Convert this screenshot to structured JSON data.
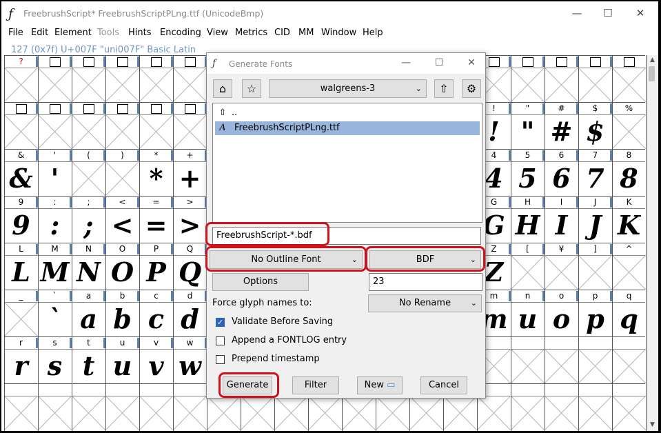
{
  "window": {
    "title": "FreebrushScript*  FreebrushScriptPLng.ttf (UnicodeBmp)",
    "app_icon": "fontforge-icon",
    "controls": {
      "minimize": "—",
      "maximize": "☐",
      "close": "✕"
    }
  },
  "menu": [
    "File",
    "Edit",
    "Element",
    "Tools",
    "Hints",
    "Encoding",
    "View",
    "Metrics",
    "CID",
    "MM",
    "Window",
    "Help"
  ],
  "menu_disabled": [
    "Tools"
  ],
  "info_line": "127 (0x7f) U+007F \"uni007F\" Basic Latin",
  "grid": {
    "rows": [
      {
        "labels": [
          "?",
          "▯",
          "▯",
          "▯",
          "▯",
          "▯",
          "",
          "",
          "",
          "",
          "",
          "",
          "",
          "",
          "▯",
          "▯",
          "▯",
          "▯",
          "▯"
        ],
        "glyphs": [
          "",
          "",
          "",
          "",
          "",
          "",
          "",
          "",
          "",
          "",
          "",
          "",
          "",
          "",
          "",
          "",
          "",
          "",
          ""
        ]
      },
      {
        "labels": [
          "▯",
          "▯",
          "▯",
          "▯",
          "▯",
          "▯",
          "",
          "",
          "",
          "",
          "",
          "",
          "",
          "",
          "!",
          "\"",
          "#",
          "$",
          "%"
        ],
        "glyphs": [
          "",
          "",
          "",
          "",
          "",
          "",
          "",
          "",
          "",
          "",
          "",
          "",
          "",
          "",
          "!",
          "\"",
          "#",
          "$",
          ""
        ]
      },
      {
        "labels": [
          "&",
          "'",
          "(",
          ")",
          "*",
          "+",
          "",
          "",
          "",
          "",
          "",
          "",
          "",
          "",
          "4",
          "5",
          "6",
          "7",
          "8"
        ],
        "glyphs": [
          "&",
          "'",
          "",
          "",
          "*",
          "+",
          "",
          "",
          "",
          "",
          "",
          "",
          "",
          "",
          "4",
          "5",
          "6",
          "7",
          "8"
        ]
      },
      {
        "labels": [
          "9",
          ":",
          ";",
          "<",
          "=",
          ">",
          "",
          "",
          "",
          "",
          "",
          "",
          "",
          "",
          "G",
          "H",
          "I",
          "J",
          "K"
        ],
        "glyphs": [
          "9",
          ":",
          ";",
          "<",
          "=",
          ">",
          "",
          "",
          "",
          "",
          "",
          "",
          "",
          "",
          "G",
          "H",
          "I",
          "J",
          "K"
        ]
      },
      {
        "labels": [
          "L",
          "M",
          "N",
          "O",
          "P",
          "Q",
          "",
          "",
          "",
          "",
          "",
          "",
          "",
          "",
          "Z",
          "[",
          "¥",
          "]",
          "^"
        ],
        "glyphs": [
          "L",
          "M",
          "N",
          "O",
          "P",
          "Q",
          "",
          "",
          "",
          "",
          "",
          "",
          "",
          "",
          "Z",
          "",
          "",
          "",
          ""
        ]
      },
      {
        "labels": [
          "_",
          "`",
          "a",
          "b",
          "c",
          "d",
          "",
          "",
          "",
          "",
          "",
          "",
          "",
          "",
          "m",
          "n",
          "o",
          "p",
          "q"
        ],
        "glyphs": [
          "",
          "`",
          "a",
          "b",
          "c",
          "d",
          "",
          "",
          "",
          "",
          "",
          "",
          "",
          "",
          "m",
          "u",
          "o",
          "p",
          "q"
        ]
      },
      {
        "labels": [
          "r",
          "s",
          "t",
          "u",
          "v",
          "w",
          "",
          "",
          "",
          "",
          "",
          "",
          "",
          "",
          "",
          "",
          "",
          "",
          ""
        ],
        "glyphs": [
          "r",
          "s",
          "t",
          "u",
          "v",
          "w",
          "",
          "",
          "",
          "",
          "",
          "",
          "",
          "",
          "",
          "",
          "",
          "",
          ""
        ]
      },
      {
        "labels": [
          "",
          "",
          "",
          "",
          "",
          "",
          "",
          "",
          "",
          "",
          "",
          "",
          "",
          "",
          "",
          "",
          "",
          "",
          ""
        ],
        "glyphs": [
          "",
          "",
          "",
          "",
          "",
          "",
          "",
          "",
          "",
          "",
          "",
          "",
          "",
          "",
          "",
          "",
          "",
          "",
          ""
        ]
      }
    ]
  },
  "dialog": {
    "title": "Generate Fonts",
    "controls": {
      "minimize": "—",
      "maximize": "☐",
      "close": "✕"
    },
    "directory": "walgreens-3",
    "files": [
      {
        "icon": "⇧",
        "name": ".."
      },
      {
        "icon": "A",
        "name": "FreebrushScriptPLng.ttf"
      }
    ],
    "filename_value": "FreebrushScript-*.bdf",
    "outline_format": "No Outline Font",
    "bitmap_format": "BDF",
    "options_label": "Options",
    "pixel_sizes": "23",
    "force_glyph_label": "Force glyph names to:",
    "rename_value": "No Rename",
    "checkboxes": [
      {
        "label": "Validate Before Saving",
        "checked": true
      },
      {
        "label": "Append a FONTLOG entry",
        "checked": false
      },
      {
        "label": "Prepend timestamp",
        "checked": false
      }
    ],
    "buttons": {
      "generate": "Generate",
      "filter": "Filter",
      "new": "New",
      "cancel": "Cancel"
    },
    "highlight_color": "#d0111d"
  }
}
